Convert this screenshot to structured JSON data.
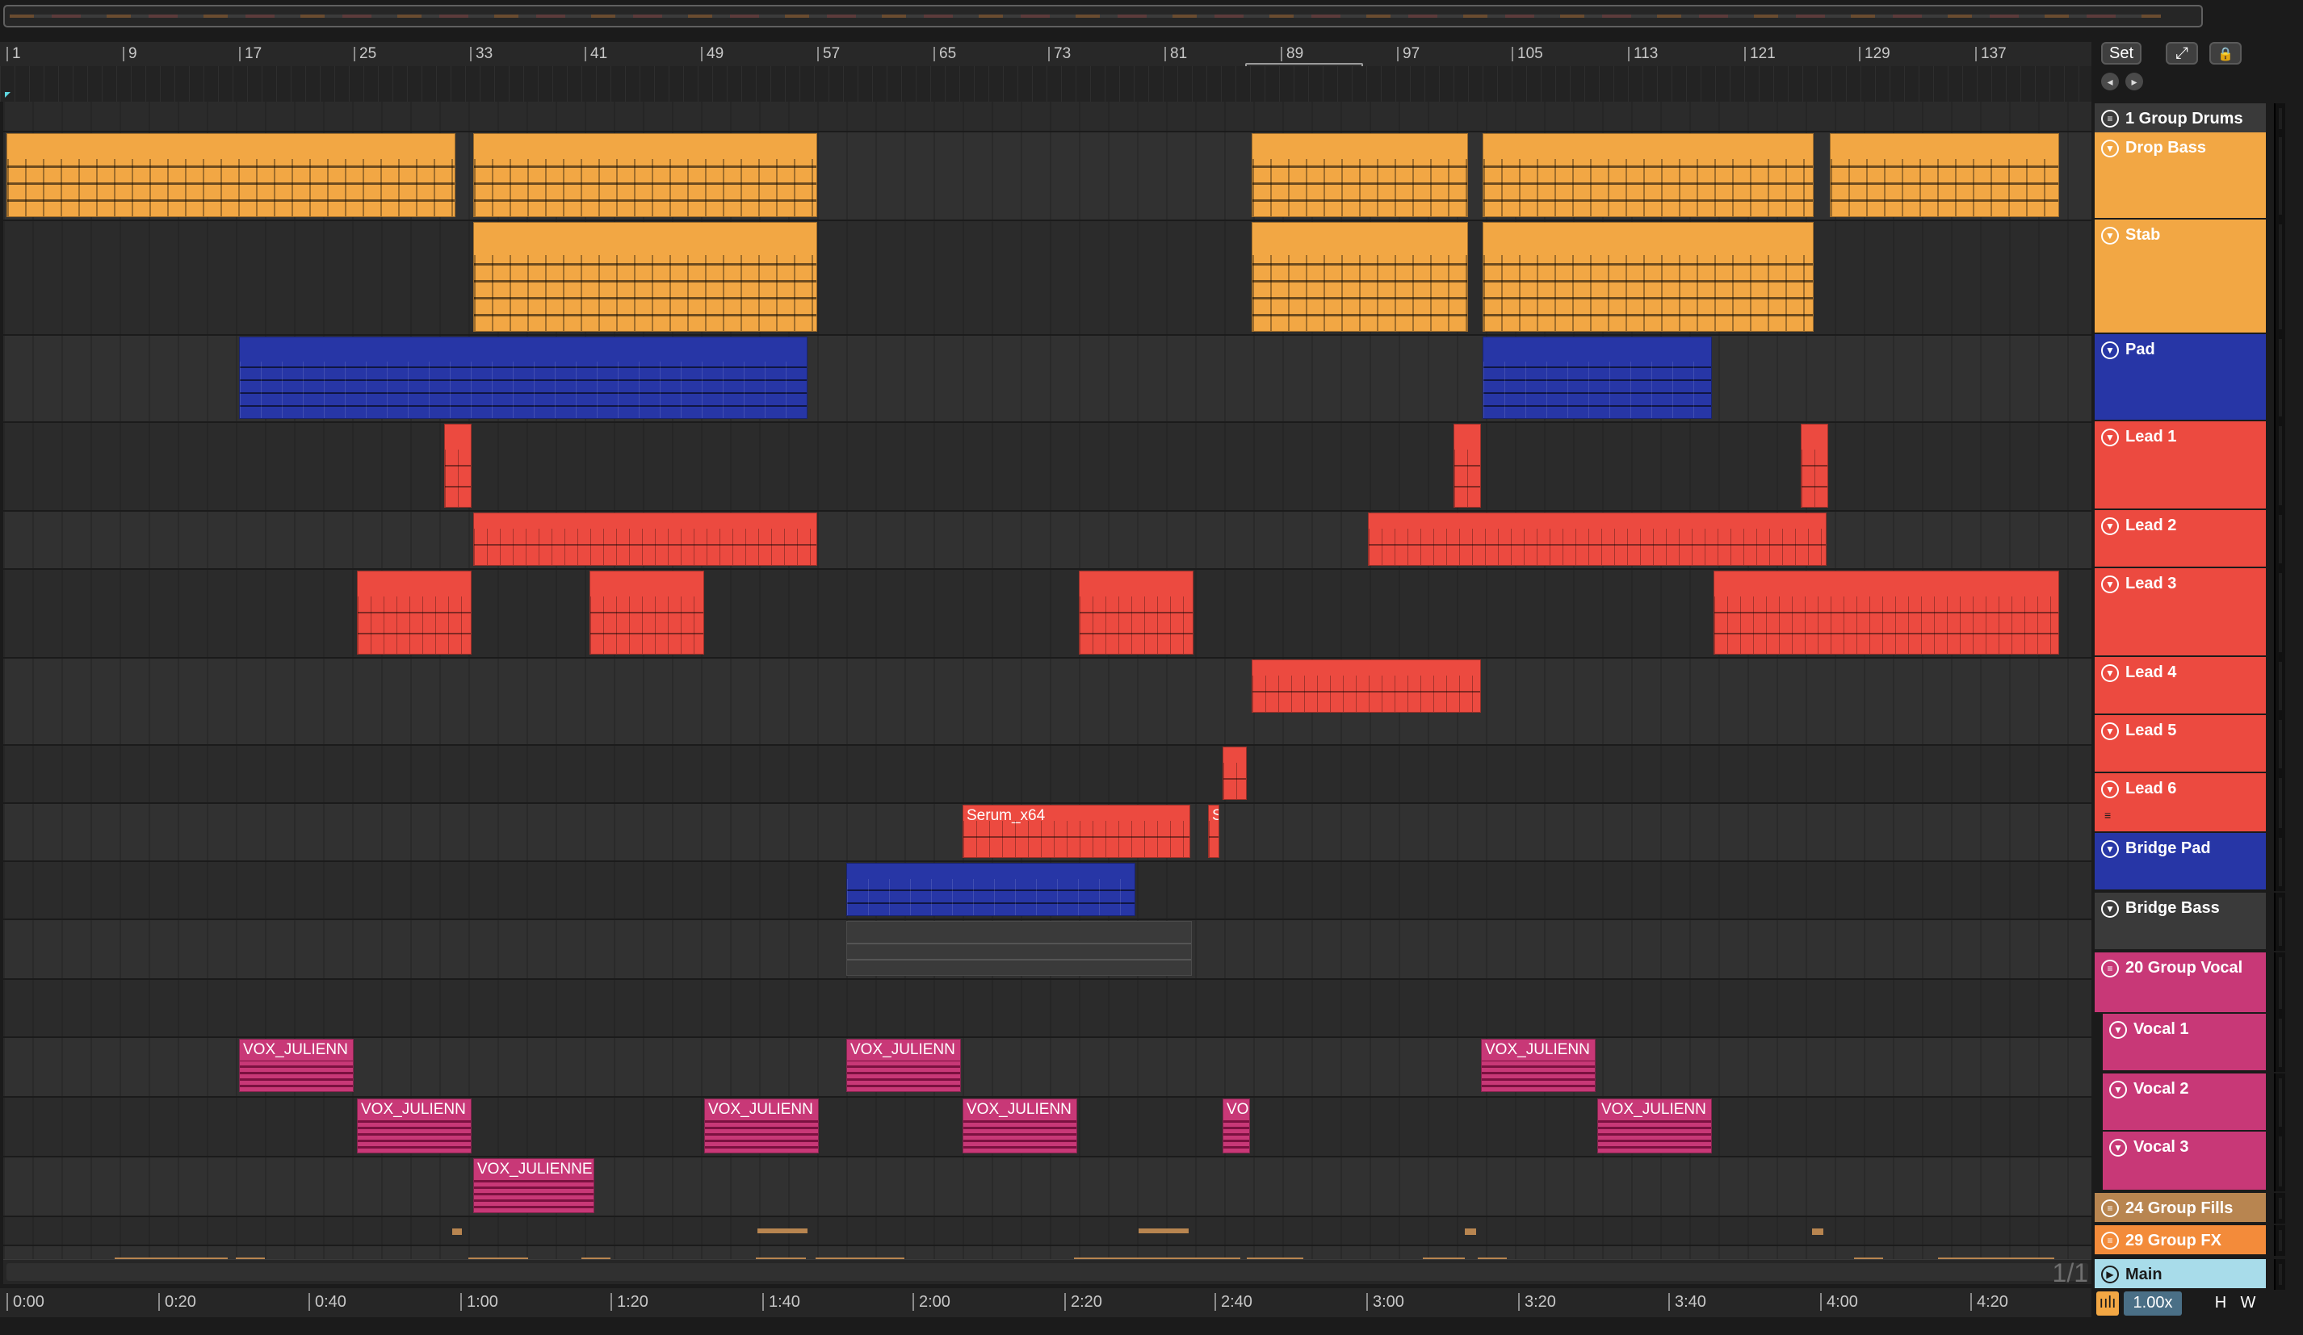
{
  "app": "Ableton Live",
  "bar_ruler": [
    "1",
    "9",
    "17",
    "25",
    "33",
    "41",
    "49",
    "57",
    "65",
    "73",
    "81",
    "89",
    "97",
    "105",
    "113",
    "121",
    "129",
    "137"
  ],
  "time_ruler": [
    "0:00",
    "0:20",
    "0:40",
    "1:00",
    "1:20",
    "1:40",
    "2:00",
    "2:20",
    "2:40",
    "3:00",
    "3:20",
    "3:40",
    "4:00",
    "4:20"
  ],
  "controls": {
    "set_label": "Set",
    "expand_icon": "expand-icon",
    "lock_icon": "lock-icon",
    "back_icon": "arrow-left-icon",
    "forward_icon": "arrow-right-icon",
    "page_counter": "1/1",
    "zoom_value": "1.00x",
    "h_label": "H",
    "w_label": "W"
  },
  "colors": {
    "orange": "#f2a744",
    "blue": "#2736a6",
    "red": "#ec4a40",
    "pink": "#c83877",
    "tan": "#b88550",
    "fx_orange": "#f38b3a",
    "main_cyan": "#a8dcea"
  },
  "tracks": [
    {
      "name": "1 Group Drums",
      "type": "group",
      "color": "#3a3a3a"
    },
    {
      "name": "Drop Bass",
      "type": "midi",
      "color": "#f2a744"
    },
    {
      "name": "Stab",
      "type": "midi",
      "color": "#f2a744"
    },
    {
      "name": "Pad",
      "type": "midi",
      "color": "#2736a6"
    },
    {
      "name": "Lead 1",
      "type": "midi",
      "color": "#ec4a40"
    },
    {
      "name": "Lead 2",
      "type": "midi",
      "color": "#ec4a40"
    },
    {
      "name": "Lead 3",
      "type": "midi",
      "color": "#ec4a40"
    },
    {
      "name": "Lead 4",
      "type": "midi",
      "color": "#ec4a40"
    },
    {
      "name": "Lead 5",
      "type": "midi",
      "color": "#ec4a40"
    },
    {
      "name": "Lead 6",
      "type": "midi",
      "color": "#ec4a40"
    },
    {
      "name": "Bridge Pad",
      "type": "midi",
      "color": "#2736a6"
    },
    {
      "name": "Bridge Bass",
      "type": "midi",
      "color": "#3a3a3a"
    },
    {
      "name": "20 Group  Vocal",
      "type": "group",
      "color": "#c83877"
    },
    {
      "name": "Vocal 1",
      "type": "audio",
      "color": "#c83877"
    },
    {
      "name": "Vocal 2",
      "type": "audio",
      "color": "#c83877"
    },
    {
      "name": "Vocal 3",
      "type": "audio",
      "color": "#c83877"
    },
    {
      "name": "24 Group Fills",
      "type": "group",
      "color": "#b88550"
    },
    {
      "name": "29 Group FX",
      "type": "group",
      "color": "#f38b3a"
    },
    {
      "name": "Main",
      "type": "main",
      "color": "#a8dcea"
    }
  ],
  "clip_names": {
    "serum": "Serum_x64",
    "serum_short": "S",
    "vox": "VOX_JULIENN",
    "vox_long": "VOX_JULIENNE",
    "vox_short": "VO"
  }
}
